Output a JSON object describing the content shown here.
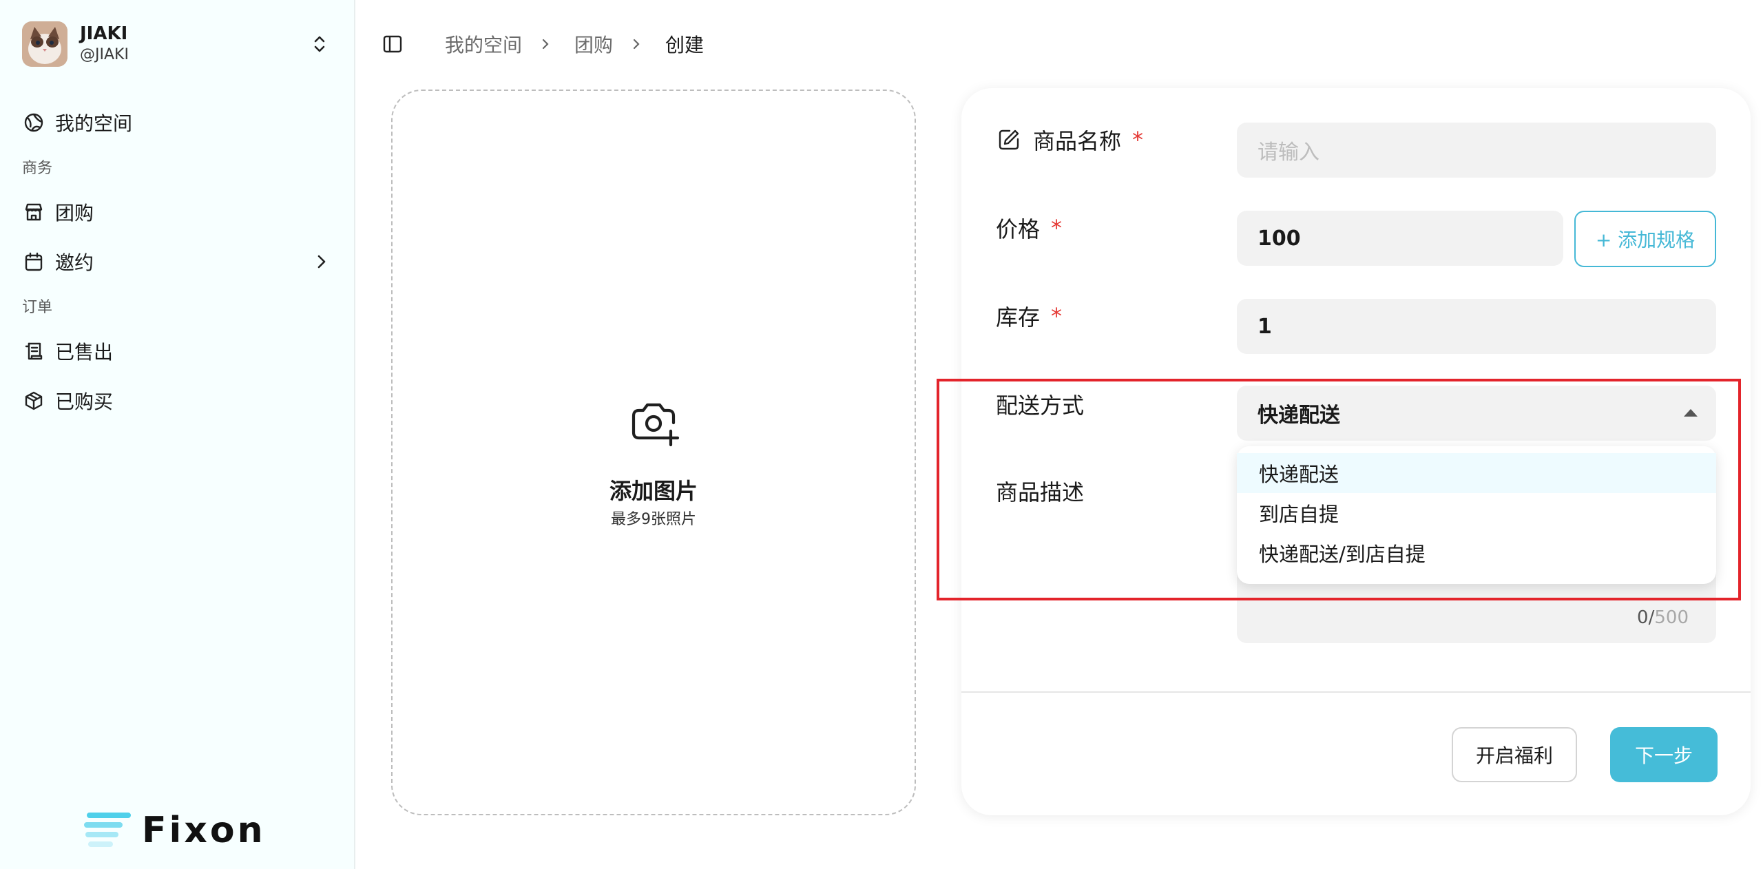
{
  "user": {
    "name": "JIAKI",
    "handle": "@JIAKI"
  },
  "sidebar": {
    "items": [
      {
        "label": "我的空间",
        "icon": "globe-icon"
      },
      {
        "label": "团购",
        "icon": "store-icon"
      },
      {
        "label": "邀约",
        "icon": "calendar-icon"
      },
      {
        "label": "已售出",
        "icon": "receipt-icon"
      },
      {
        "label": "已购买",
        "icon": "package-icon"
      }
    ],
    "sections": [
      "商务",
      "订单"
    ]
  },
  "logo": {
    "text": "Fixon"
  },
  "breadcrumb": {
    "items": [
      "我的空间",
      "团购"
    ],
    "current": "创建"
  },
  "upload": {
    "title": "添加图片",
    "hint": "最多9张照片"
  },
  "form": {
    "name": {
      "label": "商品名称",
      "required": "*",
      "placeholder": "请输入"
    },
    "price": {
      "label": "价格",
      "required": "*",
      "value": "100",
      "add_spec": "+ 添加规格"
    },
    "stock": {
      "label": "库存",
      "required": "*",
      "value": "1"
    },
    "delivery": {
      "label": "配送方式",
      "selected": "快递配送",
      "options": [
        "快递配送",
        "到店自提",
        "快递配送/到店自提"
      ]
    },
    "description": {
      "label": "商品描述",
      "count": "0",
      "max": "500"
    },
    "buttons": {
      "welfare": "开启福利",
      "next": "下一步"
    }
  },
  "colors": {
    "accent": "#45bcd8",
    "required": "#e53935",
    "highlight": "#e3242b",
    "sidebar_bg": "#f7ffff"
  }
}
